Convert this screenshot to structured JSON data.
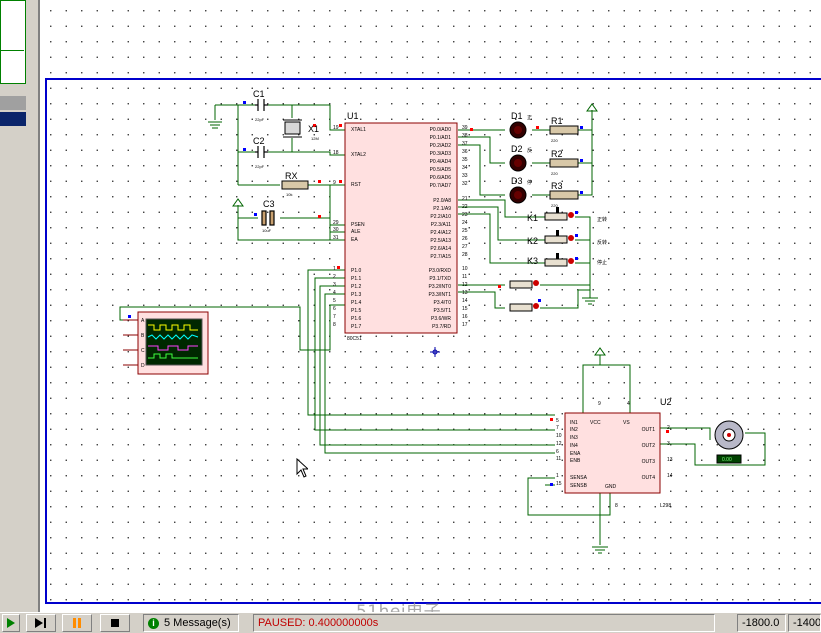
{
  "schematic": {
    "mcu": {
      "ref": "U1",
      "part": "80C51",
      "left_pins": [
        "XTAL1",
        "XTAL2",
        "RST",
        "PSEN",
        "ALE",
        "EA",
        "P1.0",
        "P1.1",
        "P1.2",
        "P1.3",
        "P1.4",
        "P1.5",
        "P1.6",
        "P1.7"
      ],
      "left_pin_nums": [
        "19",
        "18",
        "9",
        "29",
        "30",
        "31",
        "1",
        "2",
        "3",
        "4",
        "5",
        "6",
        "7",
        "8"
      ],
      "right_pins_p0": [
        "P0.0/AD0",
        "P0.1/AD1",
        "P0.2/AD2",
        "P0.3/AD3",
        "P0.4/AD4",
        "P0.5/AD5",
        "P0.6/AD6",
        "P0.7/AD7"
      ],
      "right_nums_p0": [
        "39",
        "38",
        "37",
        "36",
        "35",
        "34",
        "33",
        "32"
      ],
      "right_pins_p2": [
        "P2.0/A8",
        "P2.1/A9",
        "P2.2/A10",
        "P2.3/A11",
        "P2.4/A12",
        "P2.5/A13",
        "P2.6/A14",
        "P2.7/A15"
      ],
      "right_nums_p2": [
        "21",
        "22",
        "23",
        "24",
        "25",
        "26",
        "27",
        "28"
      ],
      "right_pins_p3": [
        "P3.0/RXD",
        "P3.1/TXD",
        "P3.2/INT0",
        "P3.3/INT1",
        "P3.4/T0",
        "P3.5/T1",
        "P3.6/WR",
        "P3.7/RD"
      ],
      "right_nums_p3": [
        "10",
        "11",
        "12",
        "13",
        "14",
        "15",
        "16",
        "17"
      ]
    },
    "capacitors": [
      {
        "ref": "C1",
        "value": "22pF"
      },
      {
        "ref": "C2",
        "value": "22pF"
      },
      {
        "ref": "C3",
        "value": "10uF"
      }
    ],
    "crystal": {
      "ref": "X1",
      "value": "12M"
    },
    "rst_resistor": {
      "ref": "RX",
      "value": "10k"
    },
    "leds": [
      {
        "ref": "D1",
        "label": "正"
      },
      {
        "ref": "D2",
        "label": "反"
      },
      {
        "ref": "D3",
        "label": "停"
      }
    ],
    "resistors": [
      {
        "ref": "R1",
        "value": "220"
      },
      {
        "ref": "R2",
        "value": "220"
      },
      {
        "ref": "R3",
        "value": "220"
      }
    ],
    "switches": [
      {
        "ref": "K1",
        "label": "正转"
      },
      {
        "ref": "K2",
        "label": "反转"
      },
      {
        "ref": "K3",
        "label": "停止"
      }
    ],
    "driver": {
      "ref": "U2",
      "part": "L298",
      "left_pins": [
        "IN1",
        "IN2",
        "IN3",
        "IN4",
        "ENA",
        "ENB",
        "SENSA",
        "SENSB"
      ],
      "left_nums": [
        "5",
        "7",
        "10",
        "12",
        "6",
        "11",
        "1",
        "15"
      ],
      "right_pins": [
        "OUT1",
        "OUT2",
        "OUT3",
        "OUT4"
      ],
      "right_nums": [
        "2",
        "3",
        "13",
        "14"
      ],
      "top_labels": [
        "VCC",
        "VS"
      ],
      "top_nums": [
        "9",
        "4"
      ],
      "bottom_label": "GND",
      "bottom_num": "8"
    },
    "scope_channels": [
      "A",
      "B",
      "C",
      "D"
    ],
    "motor_readout": "0.00"
  },
  "status": {
    "messages": "5 Message(s)",
    "sim_state": "PAUSED: 0.400000000s",
    "coord_x": "-1800.0",
    "coord_y": "-1400."
  },
  "watermark": "51hei电子",
  "colors": {
    "wire": "#006400",
    "border": "#0000cc",
    "component": "#8b0000",
    "chip": "#ffe0e0",
    "pin_red": "#ff0000",
    "pin_blue": "#0000ff",
    "status_red": "#c00000"
  }
}
